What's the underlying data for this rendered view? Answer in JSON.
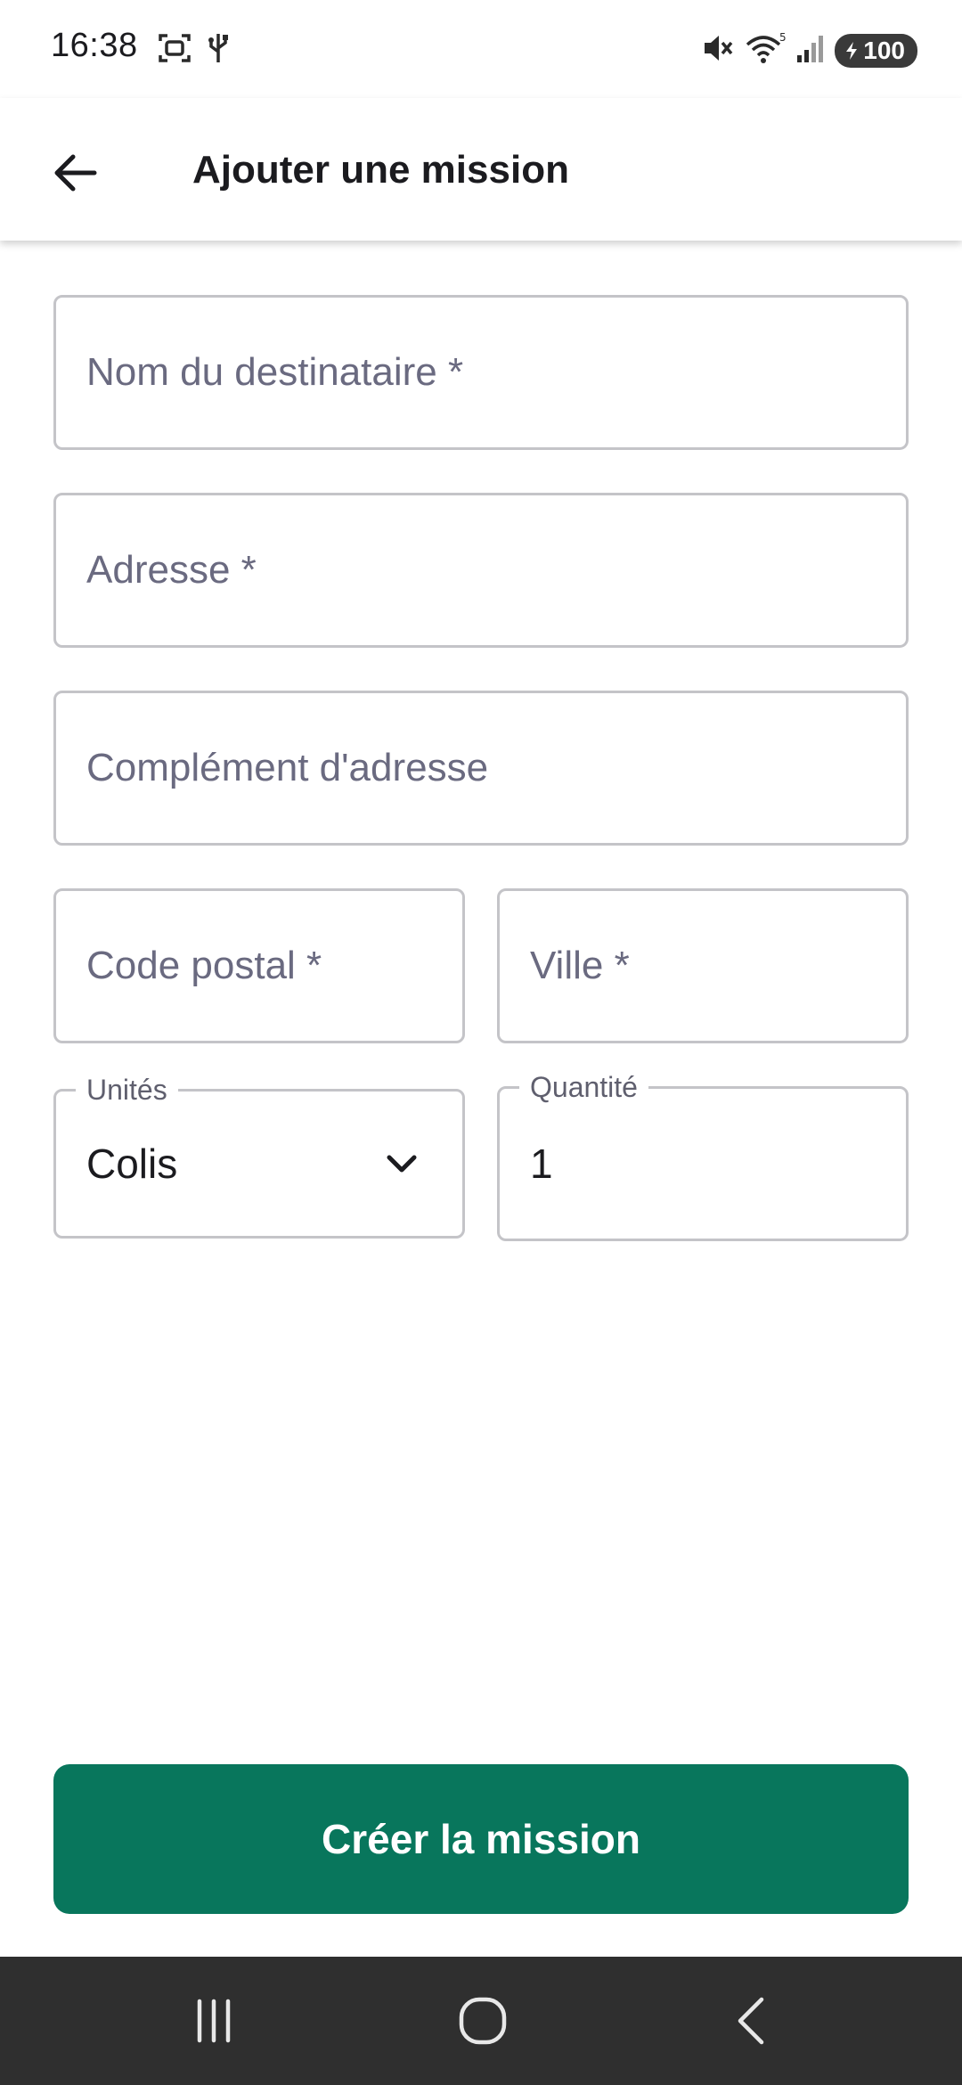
{
  "status_bar": {
    "time": "16:38",
    "battery": "100",
    "icons": [
      "screenshot-icon",
      "usb-icon",
      "mute-icon",
      "wifi-icon",
      "signal-icon",
      "battery-icon"
    ]
  },
  "app_bar": {
    "title": "Ajouter une mission",
    "back_icon": "arrow-left-icon"
  },
  "form": {
    "recipient_name": {
      "placeholder": "Nom du destinataire *",
      "value": ""
    },
    "address": {
      "placeholder": "Adresse *",
      "value": ""
    },
    "address_complement": {
      "placeholder": "Complément d'adresse",
      "value": ""
    },
    "postal_code": {
      "placeholder": "Code postal *",
      "value": ""
    },
    "city": {
      "placeholder": "Ville *",
      "value": ""
    },
    "units": {
      "label": "Unités",
      "selected": "Colis"
    },
    "quantity": {
      "label": "Quantité",
      "value": "1"
    }
  },
  "actions": {
    "create_label": "Créer la mission"
  },
  "nav_bar": {
    "icons": [
      "recent-apps-icon",
      "home-icon",
      "back-icon"
    ]
  },
  "colors": {
    "accent": "#08765c",
    "border": "#c4c4c8",
    "placeholder": "#6a6a80",
    "nav_background": "#2f2f2f"
  }
}
